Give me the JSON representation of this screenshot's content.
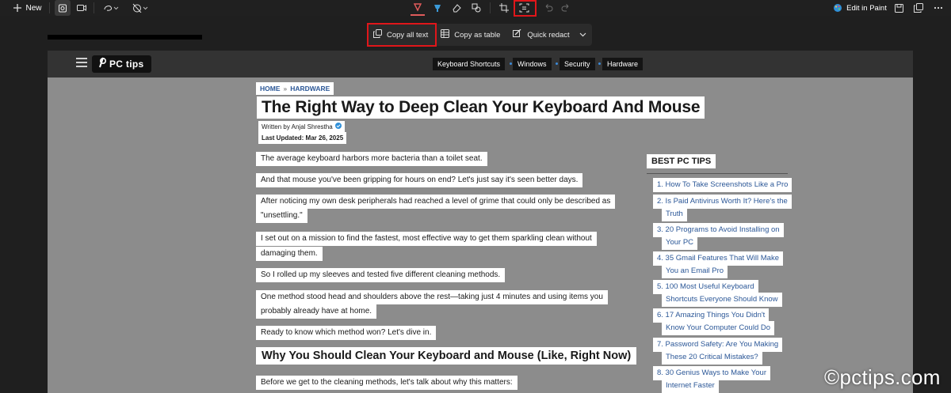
{
  "toolbar": {
    "new_label": "New",
    "edit_in_paint_label": "Edit in Paint"
  },
  "text_actions": {
    "copy_all_text": "Copy all text",
    "copy_as_table": "Copy as table",
    "quick_redact": "Quick redact"
  },
  "site": {
    "logo_text": "PC tips",
    "nav": [
      "Keyboard Shortcuts",
      "Windows",
      "Security",
      "Hardware"
    ]
  },
  "article": {
    "breadcrumb": [
      "HOME",
      "»",
      "HARDWARE"
    ],
    "title": "The Right Way to Deep Clean Your Keyboard And Mouse",
    "written_by": "Written by Anjal Shrestha",
    "last_updated": "Last Updated: Mar 26, 2025",
    "paragraphs": [
      "The average keyboard harbors more bacteria than a toilet seat.",
      "And that mouse you've been gripping for hours on end? Let's just say it's seen better days.",
      "After noticing my own desk peripherals had reached a level of grime that could only be described as",
      "\"unsettling.\"",
      "I set out on a mission to find the fastest, most effective way to get them sparkling clean without",
      "damaging them.",
      "So I rolled up my sleeves and tested five different cleaning methods.",
      "One method stood head and shoulders above the rest—taking just 4 minutes and using items you",
      "probably already have at home.",
      "Ready to know which method won? Let's dive in."
    ],
    "heading2": "Why You Should Clean Your Keyboard and Mouse (Like, Right Now)",
    "last_paragraph": "Before we get to the cleaning methods, let's talk about why this matters:"
  },
  "sidebar": {
    "title": "BEST PC TIPS",
    "items": [
      "1. How To Take Screenshots Like a Pro",
      "2. Is Paid Antivirus Worth It? Here's the",
      "Truth",
      "3. 20 Programs to Avoid Installing on",
      "Your PC",
      "4. 35 Gmail Features That Will Make",
      "You an Email Pro",
      "5. 100 Most Useful Keyboard",
      "Shortcuts Everyone Should Know",
      "6. 17 Amazing Things You Didn't",
      "Know Your Computer Could Do",
      "7. Password Safety: Are You Making",
      "These 20 Critical Mistakes?",
      "8. 30 Genius Ways to Make Your",
      "Internet Faster"
    ]
  },
  "watermark": "©pctips.com",
  "colors": {
    "highlight_box": "#e0161a",
    "toolbar_bg": "#202020",
    "link_blue": "#2b5797",
    "capture_dim": "#8c8c8c"
  }
}
